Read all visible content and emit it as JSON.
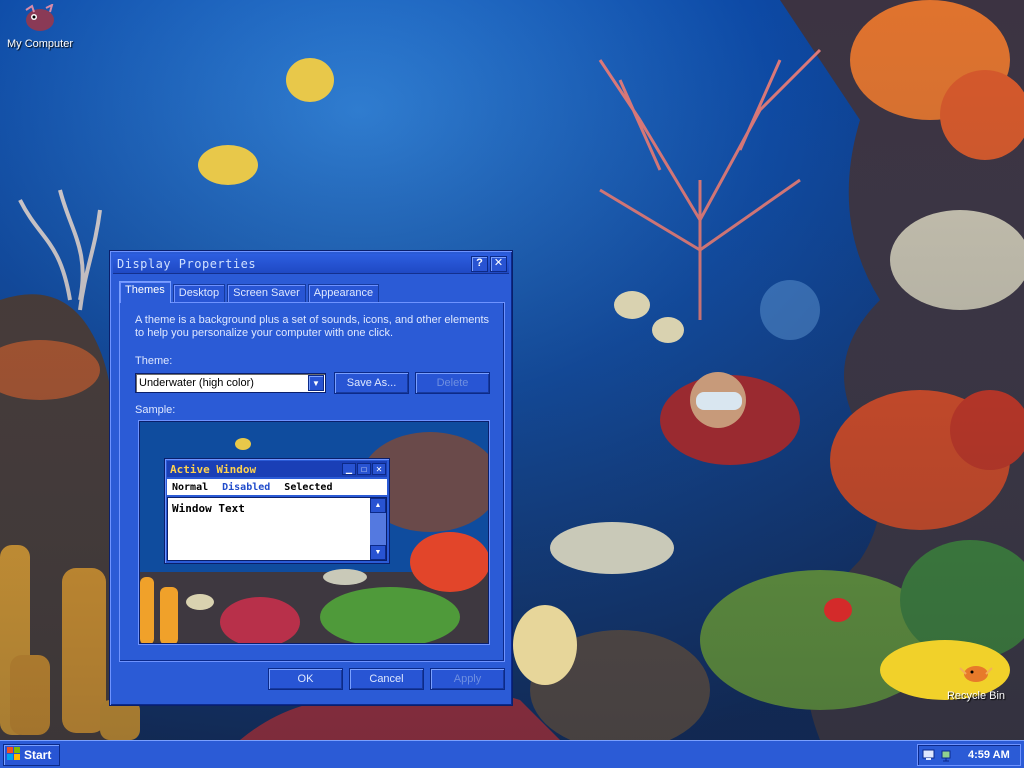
{
  "desktop": {
    "icons": [
      {
        "label": "My Computer"
      },
      {
        "label": "Recycle Bin"
      }
    ]
  },
  "window": {
    "title": "Display Properties",
    "help_button": "?",
    "close_button": "✕",
    "tabs": [
      {
        "label": "Themes",
        "active": true
      },
      {
        "label": "Desktop",
        "active": false
      },
      {
        "label": "Screen Saver",
        "active": false
      },
      {
        "label": "Appearance",
        "active": false
      }
    ],
    "description": "A theme is a background plus a set of sounds, icons, and other elements to help you personalize your computer with one click.",
    "theme_label": "Theme:",
    "theme_value": "Underwater (high color)",
    "save_as_label": "Save As...",
    "delete_label": "Delete",
    "sample_label": "Sample:",
    "sample": {
      "title": "Active Window",
      "menu_normal": "Normal",
      "menu_disabled": "Disabled",
      "menu_selected": "Selected",
      "body_text": "Window Text"
    },
    "ok_label": "OK",
    "cancel_label": "Cancel",
    "apply_label": "Apply"
  },
  "taskbar": {
    "start_label": "Start",
    "clock": "4:59 AM"
  },
  "colors": {
    "window_face": "#2b5bd6",
    "title_text": "#cfe0ff",
    "sample_title_text": "#ffd24d",
    "taskbar": "#2b5bd6"
  }
}
